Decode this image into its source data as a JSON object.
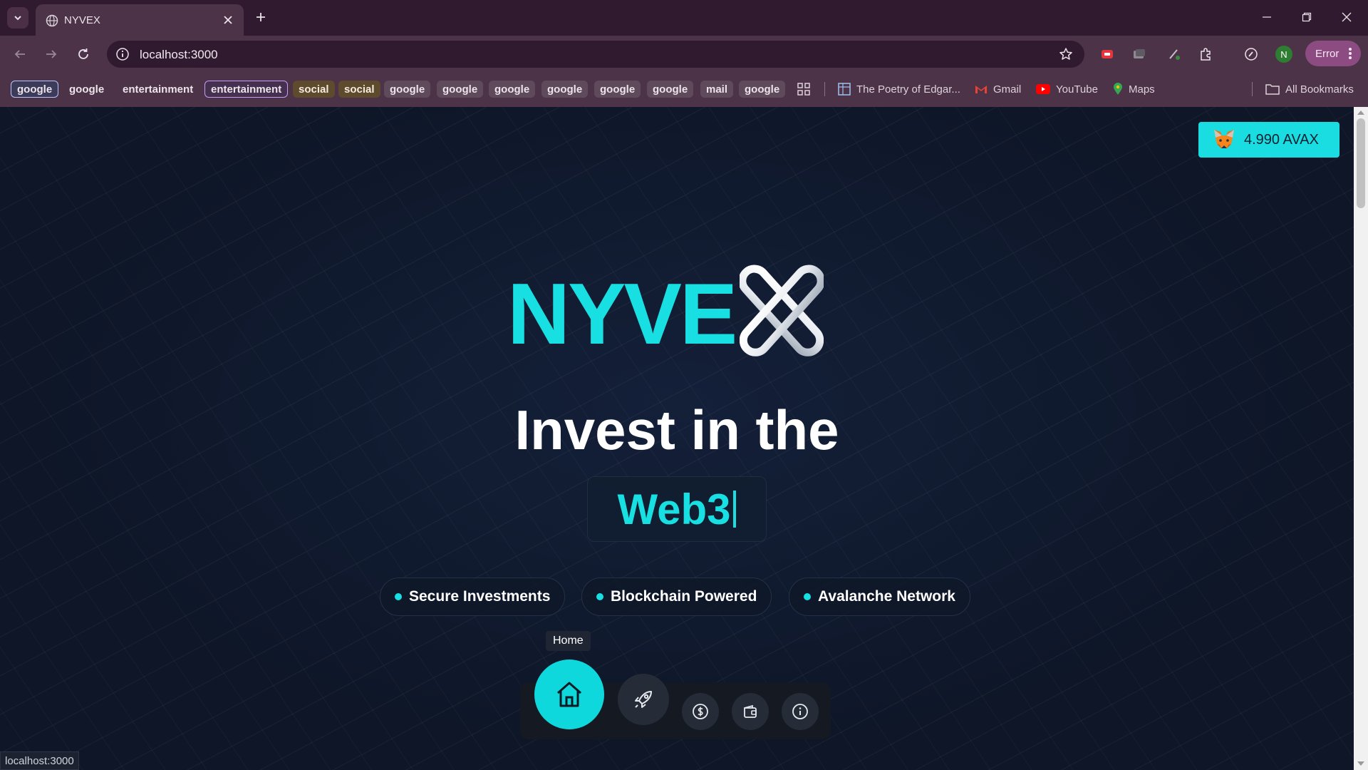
{
  "browser": {
    "tab_title": "NYVEX",
    "url": "localhost:3000",
    "error_label": "Error",
    "profile_initial": "N",
    "status_url": "localhost:3000"
  },
  "bookmarks": {
    "chips": [
      "google",
      "google",
      "entertainment",
      "entertainment",
      "social",
      "social",
      "google",
      "google",
      "google",
      "google",
      "google",
      "google",
      "mail",
      "google"
    ],
    "links": [
      "The Poetry of Edgar...",
      "Gmail",
      "YouTube",
      "Maps"
    ],
    "all_bookmarks": "All Bookmarks"
  },
  "wallet": {
    "amount": "4.990 AVAX"
  },
  "hero": {
    "logo_text": "NYVE",
    "headline": "Invest in the",
    "typed_word": "Web3"
  },
  "features": [
    "Secure Investments",
    "Blockchain Powered",
    "Avalanche Network"
  ],
  "dock": {
    "tooltip": "Home"
  },
  "colors": {
    "accent": "#18e0e2",
    "background": "#0e1627",
    "chrome": "#4c3348"
  }
}
